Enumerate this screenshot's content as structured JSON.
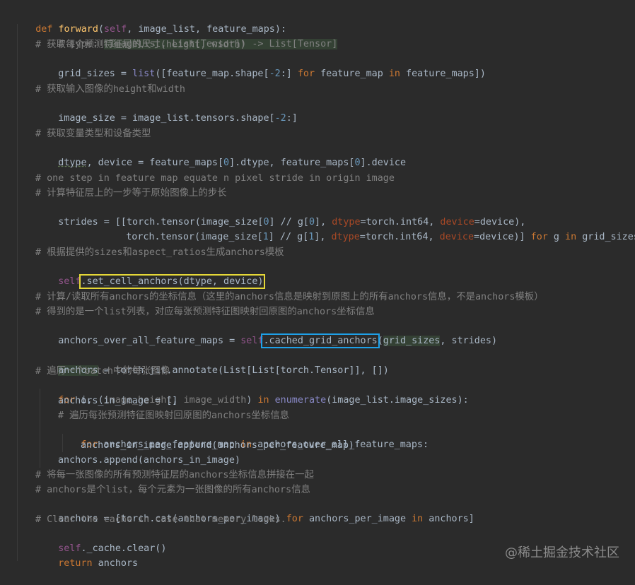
{
  "code": {
    "l1": {
      "kw": "def",
      "fn": "forward",
      "p1": "(",
      "self": "self",
      "p2": ", ",
      "a1": "image_list",
      "p3": ", ",
      "a2": "feature_maps",
      "p4": "):"
    },
    "l2": {
      "c1": "# type: ",
      "c2": "(ImageList, List[Tensor]) -> List[Tensor]"
    },
    "l3": {
      "c": "# 获取每个预测特征层的尺寸(height, width)"
    },
    "l4": {
      "t1": "grid_sizes = ",
      "bi": "list",
      "t2": "([feature_map.shape[",
      "n": "-2",
      "t3": ":] ",
      "k1": "for",
      "t4": " feature_map ",
      "k2": "in",
      "t5": " feature_maps])"
    },
    "l5": {
      "c": "# 获取输入图像的height和width"
    },
    "l6": {
      "t1": "image_size = image_list.tensors.shape[",
      "n": "-2",
      "t2": ":]"
    },
    "l7": {
      "c": "# 获取变量类型和设备类型"
    },
    "l8": {
      "v": "dtype",
      "t1": ", device = feature_maps[",
      "n1": "0",
      "t2": "].dtype, feature_maps[",
      "n2": "0",
      "t3": "].device"
    },
    "l9": {
      "c": "# one step in feature map equate n pixel stride in origin image"
    },
    "l10": {
      "c": "# 计算特征层上的一步等于原始图像上的步长"
    },
    "l11": {
      "t1": "strides = [[torch.tensor(image_size[",
      "n1": "0",
      "t2": "] // g[",
      "n2": "0",
      "t3": "], ",
      "a1": "dtype",
      "t4": "=torch.int64, ",
      "a2": "device",
      "t5": "=device),"
    },
    "l12": {
      "t1": "torch.tensor(image_size[",
      "n1": "1",
      "t2": "] // g[",
      "n2": "1",
      "t3": "], ",
      "a1": "dtype",
      "t4": "=torch.int64, ",
      "a2": "device",
      "t5": "=device)] ",
      "k1": "for",
      "t6": " g ",
      "k2": "in",
      "t7": " grid_sizes]"
    },
    "l13": {
      "c": "# 根据提供的sizes和aspect_ratios生成anchors模板"
    },
    "l14": {
      "self": "self",
      "t1": ".set_cell_anchors(dtype, device)"
    },
    "l15": {
      "c": "# 计算/读取所有anchors的坐标信息（这里的anchors信息是映射到原图上的所有anchors信息，不是anchors模板）"
    },
    "l16": {
      "c": "# 得到的是一个list列表，对应每张预测特征图映射回原图的anchors坐标信息"
    },
    "l17": {
      "t1": "anchors_over_all_feature_maps = ",
      "self": "self",
      "t2": ".cached_grid_anchors",
      "t3": "(",
      "v": "grid_sizes",
      "t4": ", strides)"
    },
    "l18": {
      "v": "anchors",
      "t1": " = torch.jit.annotate(List[List[torch.Tensor]], [])"
    },
    "l19": {
      "c": "# 遍历一个batch中的每张图像"
    },
    "l20": {
      "k1": "for",
      "t1": " i, (",
      "v1": "image_height",
      "t2": ", ",
      "v2": "image_width",
      "t3": ") ",
      "k2": "in",
      "t4": " ",
      "bi": "enumerate",
      "t5": "(image_list.image_sizes):"
    },
    "l21": {
      "t1": "anchors_in_image = []"
    },
    "l22": {
      "c": "# 遍历每张预测特征图映射回原图的anchors坐标信息"
    },
    "l23": {
      "k1": "for",
      "t1": " anchors_per_feature_map ",
      "k2": "in",
      "t2": " anchors_over_all_feature_maps:"
    },
    "l24": {
      "t1": "anchors_in_image.append(anchors_per_feature_map)"
    },
    "l25": {
      "t1": "anchors.append(anchors_in_image)"
    },
    "l26": {
      "c": "# 将每一张图像的所有预测特征层的anchors坐标信息拼接在一起"
    },
    "l27": {
      "c": "# anchors是个list，每个元素为一张图像的所有anchors信息"
    },
    "l28": {
      "t1": "anchors = [torch.cat(anchors_per_image) ",
      "k1": "for",
      "t2": " anchors_per_image ",
      "k2": "in",
      "t3": " anchors]"
    },
    "l29": {
      "c": "# Clear the cache in case that memory leaks."
    },
    "l30": {
      "self": "self",
      "t1": "._cache.clear()"
    },
    "l31": {
      "k": "return",
      "t1": " anchors"
    }
  },
  "watermark": "@稀土掘金技术社区",
  "colors": {
    "background": "#2b2b2b",
    "keyword": "#cc7832",
    "function": "#ffc66d",
    "self": "#94558d",
    "comment": "#808080",
    "number": "#6897bb",
    "yellow_box": "#e5d738",
    "blue_box": "#1ea0e8"
  }
}
